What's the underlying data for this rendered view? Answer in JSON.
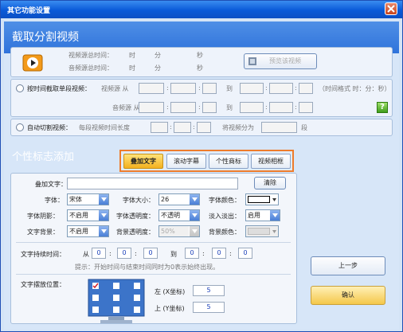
{
  "window": {
    "title": "其它功能设置"
  },
  "section1": {
    "title": "截取分割视频",
    "video_total_time_label": "视频源总时间：",
    "audio_total_time_label": "音频源总时间：",
    "hour": "时",
    "minute": "分",
    "second": "秒",
    "preview_button": "预览该视频",
    "by_time_label": "按时间截取单段视频：",
    "video_source_from": "视频源 从",
    "audio_source_from": "音频源 从",
    "to": "到",
    "colon": ":",
    "time_format_hint": "（时间格式 时：分：秒）",
    "help_icon": "?",
    "auto_cut_label": "自动切割视频：",
    "each_segment_label": "每段视频时间长度",
    "split_into_label": "将视频分为",
    "segments_unit": "段"
  },
  "section2": {
    "title": "个性标志添加",
    "tabs": [
      {
        "label": "叠加文字",
        "active": true
      },
      {
        "label": "滚动字幕",
        "active": false
      },
      {
        "label": "个性商标",
        "active": false
      },
      {
        "label": "视频相框",
        "active": false
      }
    ],
    "overlay_text_label": "叠加文字：",
    "overlay_text_value": "",
    "clear_button": "清除",
    "font_label": "字体：",
    "font_value": "宋体",
    "font_size_label": "字体大小：",
    "font_size_value": "26",
    "font_color_label": "字体颜色：",
    "shadow_label": "字体阴影：",
    "shadow_value": "不启用",
    "opacity_label": "字体透明度：",
    "opacity_value": "不透明",
    "fade_label": "淡入淡出：",
    "fade_value": "启用",
    "background_label": "文字背景：",
    "background_value": "不启用",
    "bg_opacity_label": "背景透明度：",
    "bg_opacity_value": "50%",
    "bg_color_label": "背景颜色：",
    "duration_label": "文字持续时间：",
    "from": "从",
    "to": "到",
    "colon": ":",
    "start_h": "0",
    "start_m": "0",
    "start_s": "0",
    "end_h": "0",
    "end_m": "0",
    "end_s": "0",
    "duration_hint": "提示：开始时间与结束时间同时为0表示始终出现。",
    "position_label": "文字摆放位置：",
    "left_label": "左 (X坐标)",
    "left_value": "5",
    "top_label": "上 (Y坐标)",
    "top_value": "5"
  },
  "buttons": {
    "back": "上一步",
    "confirm": "确认"
  },
  "colors": {
    "title_bar": "#0a5ad8",
    "active_tab": "#f3b11e",
    "tab_highlight": "#ee7c2b"
  }
}
